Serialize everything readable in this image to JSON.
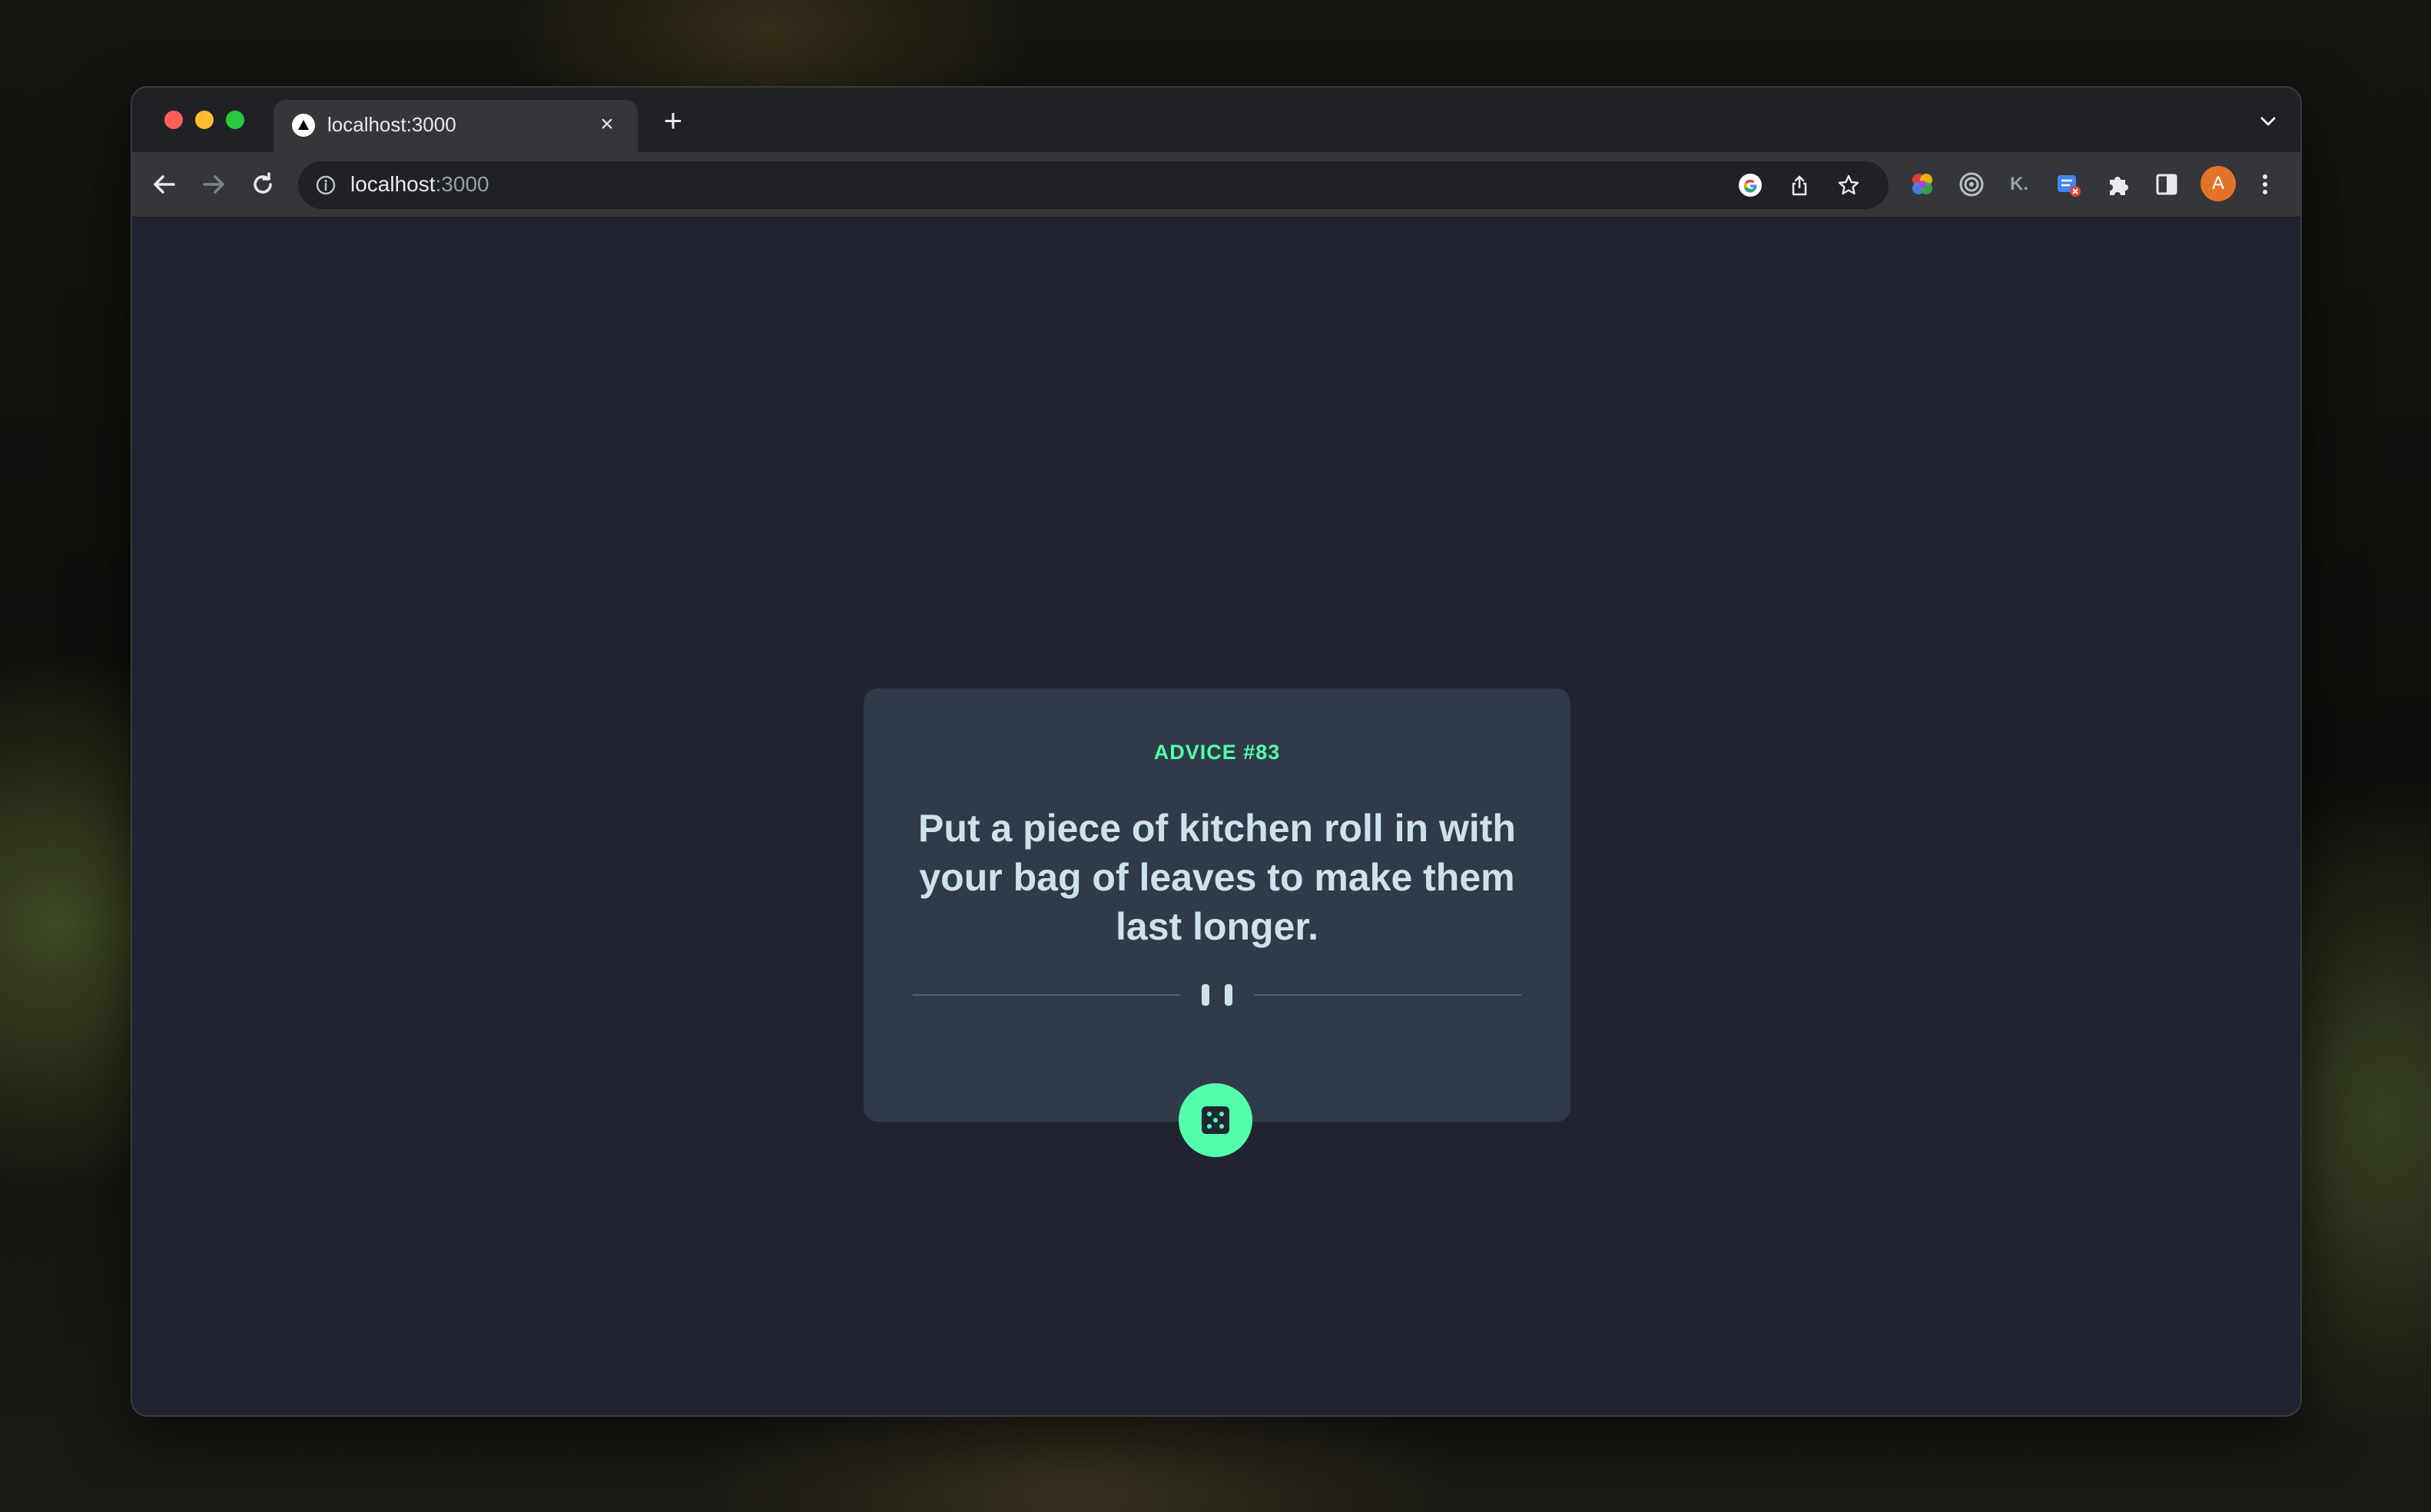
{
  "browser": {
    "tab": {
      "title": "localhost:3000",
      "close_glyph": "×"
    },
    "new_tab_glyph": "+",
    "address_bar": {
      "host": "localhost",
      "port": ":3000"
    },
    "profile_initial": "A",
    "extension_k_label": "K."
  },
  "advice": {
    "id_label": "ADVICE #83",
    "text": "Put a piece of kitchen roll in with your bag of leaves to make them last longer."
  },
  "colors": {
    "accent": "#53ffaa",
    "card": "#313a49",
    "page_background": "#1f2430",
    "advice_text": "#cee3e9"
  },
  "icons": {
    "dice_button": "dice-icon",
    "divider": "pause-icon"
  }
}
